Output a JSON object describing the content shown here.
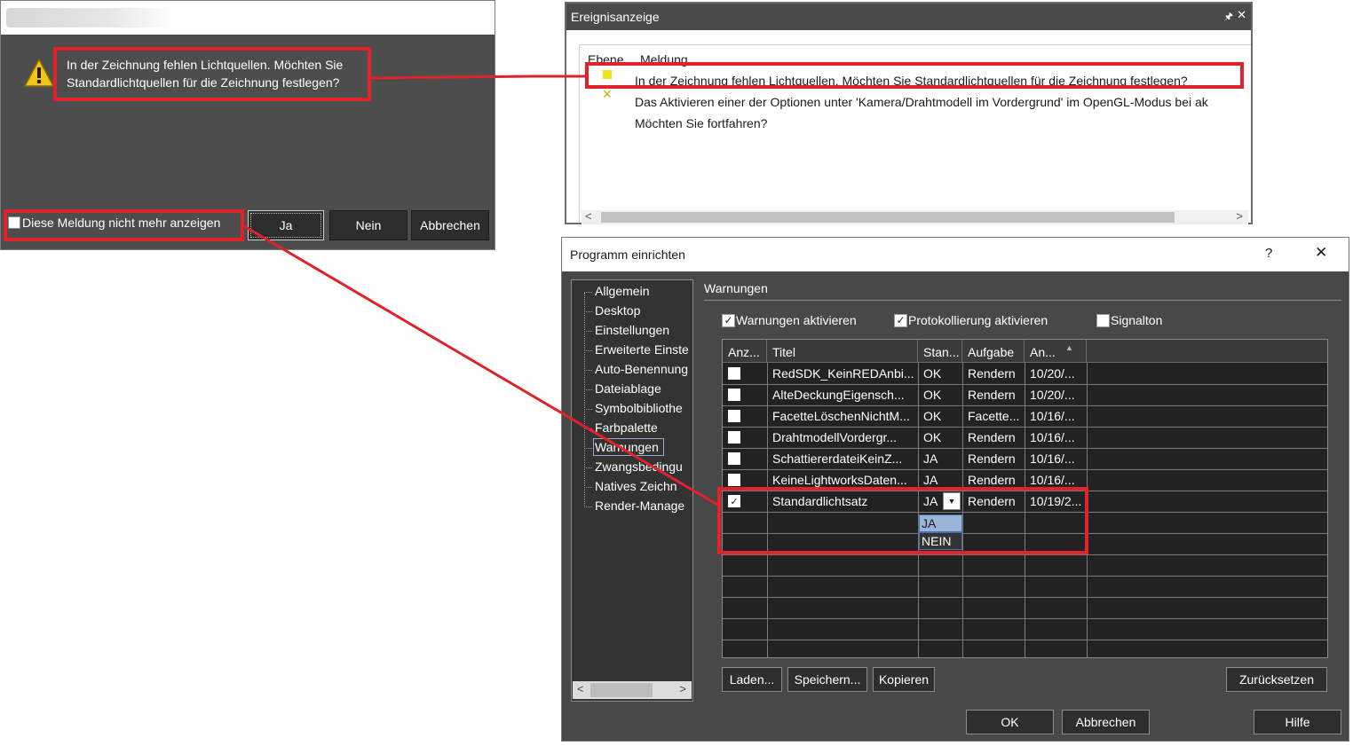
{
  "message_dialog": {
    "message": "In der Zeichnung fehlen Lichtquellen. Möchten Sie Standardlichtquellen für die Zeichnung festlegen?",
    "checkbox_label": "Diese Meldung nicht mehr anzeigen",
    "buttons": {
      "yes": "Ja",
      "no": "Nein",
      "cancel": "Abbrechen"
    }
  },
  "event_viewer": {
    "title": "Ereignisanzeige",
    "columns": {
      "level": "Ebene",
      "message": "Meldung"
    },
    "rows": [
      "In der Zeichnung fehlen Lichtquellen. Möchten Sie Standardlichtquellen für die Zeichnung festlegen?",
      "Das Aktivieren einer der Optionen unter 'Kamera/Drahtmodell im Vordergrund' im OpenGL-Modus bei ak",
      "Möchten Sie fortfahren?"
    ]
  },
  "settings": {
    "title": "Programm einrichten",
    "help_glyph": "?",
    "close_glyph": "✕",
    "tree": [
      "Allgemein",
      "Desktop",
      "Einstellungen",
      "Erweiterte Einste",
      "Auto-Benennung",
      "Dateiablage",
      "Symbolbibliothe",
      "Farbpalette",
      "Warnungen",
      "Zwangsbedingu",
      "Natives Zeichn",
      "Render-Manage"
    ],
    "section_title": "Warnungen",
    "options": {
      "enable_warnings": "Warnungen aktivieren",
      "enable_logging": "Protokollierung aktivieren",
      "beep": "Signalton"
    },
    "table": {
      "headers": [
        "Anz...",
        "Titel",
        "Stan...",
        "Aufgabe",
        "An..."
      ],
      "rows": [
        {
          "checked": false,
          "title": "RedSDK_KeinREDAnbi...",
          "standard": "OK",
          "task": "Rendern",
          "date": "10/20/..."
        },
        {
          "checked": false,
          "title": "AlteDeckungEigensch...",
          "standard": "OK",
          "task": "Rendern",
          "date": "10/20/..."
        },
        {
          "checked": false,
          "title": "FacetteLöschenNichtM...",
          "standard": "OK",
          "task": "Facette...",
          "date": "10/16/..."
        },
        {
          "checked": false,
          "title": "DrahtmodellVordergr...",
          "standard": "OK",
          "task": "Rendern",
          "date": "10/16/..."
        },
        {
          "checked": false,
          "title": "SchattiererdateiKeinZ...",
          "standard": "JA",
          "task": "Rendern",
          "date": "10/16/..."
        },
        {
          "checked": false,
          "title": "KeineLightworksDaten...",
          "standard": "JA",
          "task": "Rendern",
          "date": "10/16/..."
        },
        {
          "checked": true,
          "title": "Standardlichtsatz",
          "standard": "JA",
          "task": "Rendern",
          "date": "10/19/2..."
        }
      ],
      "dropdown_options": [
        "JA",
        "NEIN"
      ]
    },
    "buttons": {
      "load": "Laden...",
      "save": "Speichern...",
      "copy": "Kopieren",
      "reset": "Zurücksetzen",
      "ok": "OK",
      "cancel": "Abbrechen",
      "help": "Hilfe"
    }
  },
  "colors": {
    "highlight": "#e0222a",
    "dialog_dark": "#4d4d4d",
    "selection_blue": "#99b4d8"
  }
}
